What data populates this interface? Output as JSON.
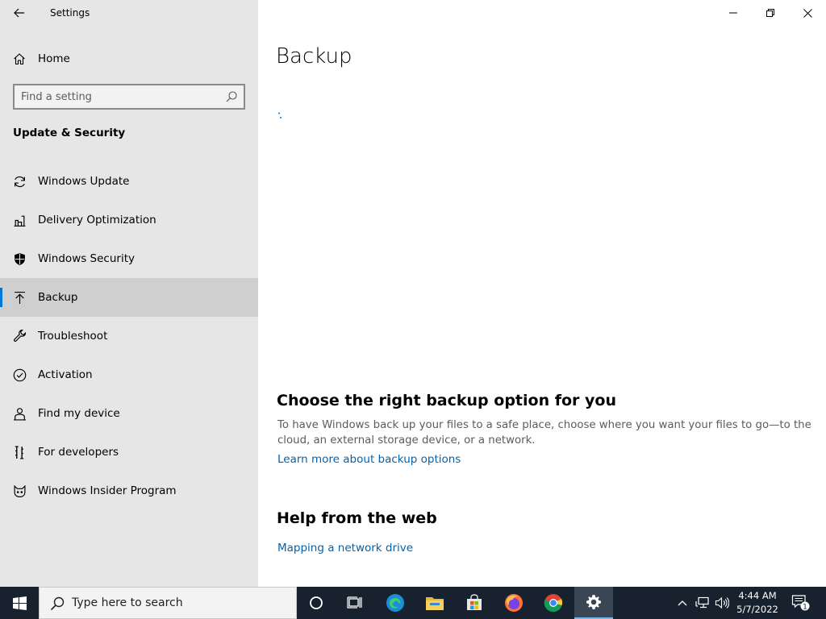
{
  "window": {
    "app_title": "Settings",
    "icons": {
      "back": "back-arrow-icon",
      "minimize": "minimize-icon",
      "restore": "restore-icon",
      "close": "close-icon"
    }
  },
  "sidebar": {
    "home_label": "Home",
    "search_placeholder": "Find a setting",
    "section_heading": "Update & Security",
    "items": [
      {
        "label": "Windows Update",
        "icon": "refresh-icon",
        "selected": false
      },
      {
        "label": "Delivery Optimization",
        "icon": "delivery-optimization-icon",
        "selected": false
      },
      {
        "label": "Windows Security",
        "icon": "shield-icon",
        "selected": false
      },
      {
        "label": "Backup",
        "icon": "upload-arrow-icon",
        "selected": true
      },
      {
        "label": "Troubleshoot",
        "icon": "wrench-icon",
        "selected": false
      },
      {
        "label": "Activation",
        "icon": "check-circle-icon",
        "selected": false
      },
      {
        "label": "Find my device",
        "icon": "person-pin-icon",
        "selected": false
      },
      {
        "label": "For developers",
        "icon": "developer-tools-icon",
        "selected": false
      },
      {
        "label": "Windows Insider Program",
        "icon": "insider-cat-icon",
        "selected": false
      }
    ]
  },
  "main": {
    "title": "Backup",
    "loading": true,
    "choose_heading": "Choose the right backup option for you",
    "choose_text": "To have Windows back up your files to a safe place, choose where you want your files to go—to the cloud, an external storage device, or a network.",
    "learn_more_link": "Learn more about backup options",
    "help_heading": "Help from the web",
    "help_link": "Mapping a network drive"
  },
  "taskbar": {
    "search_placeholder": "Type here to search",
    "apps": [
      "cortana-icon",
      "task-view-icon",
      "edge-icon",
      "file-explorer-icon",
      "store-icon",
      "firefox-icon",
      "chrome-icon",
      "settings-gear-icon"
    ],
    "active_app": "settings-gear-icon",
    "time": "4:44 AM",
    "date": "5/7/2022",
    "notification_count": "1"
  },
  "colors": {
    "sidebar_bg": "#e6e6e6",
    "selected_bg": "#cfcfcf",
    "accent": "#0078d7",
    "link": "#0063b1",
    "taskbar_bg": "#18212e"
  }
}
